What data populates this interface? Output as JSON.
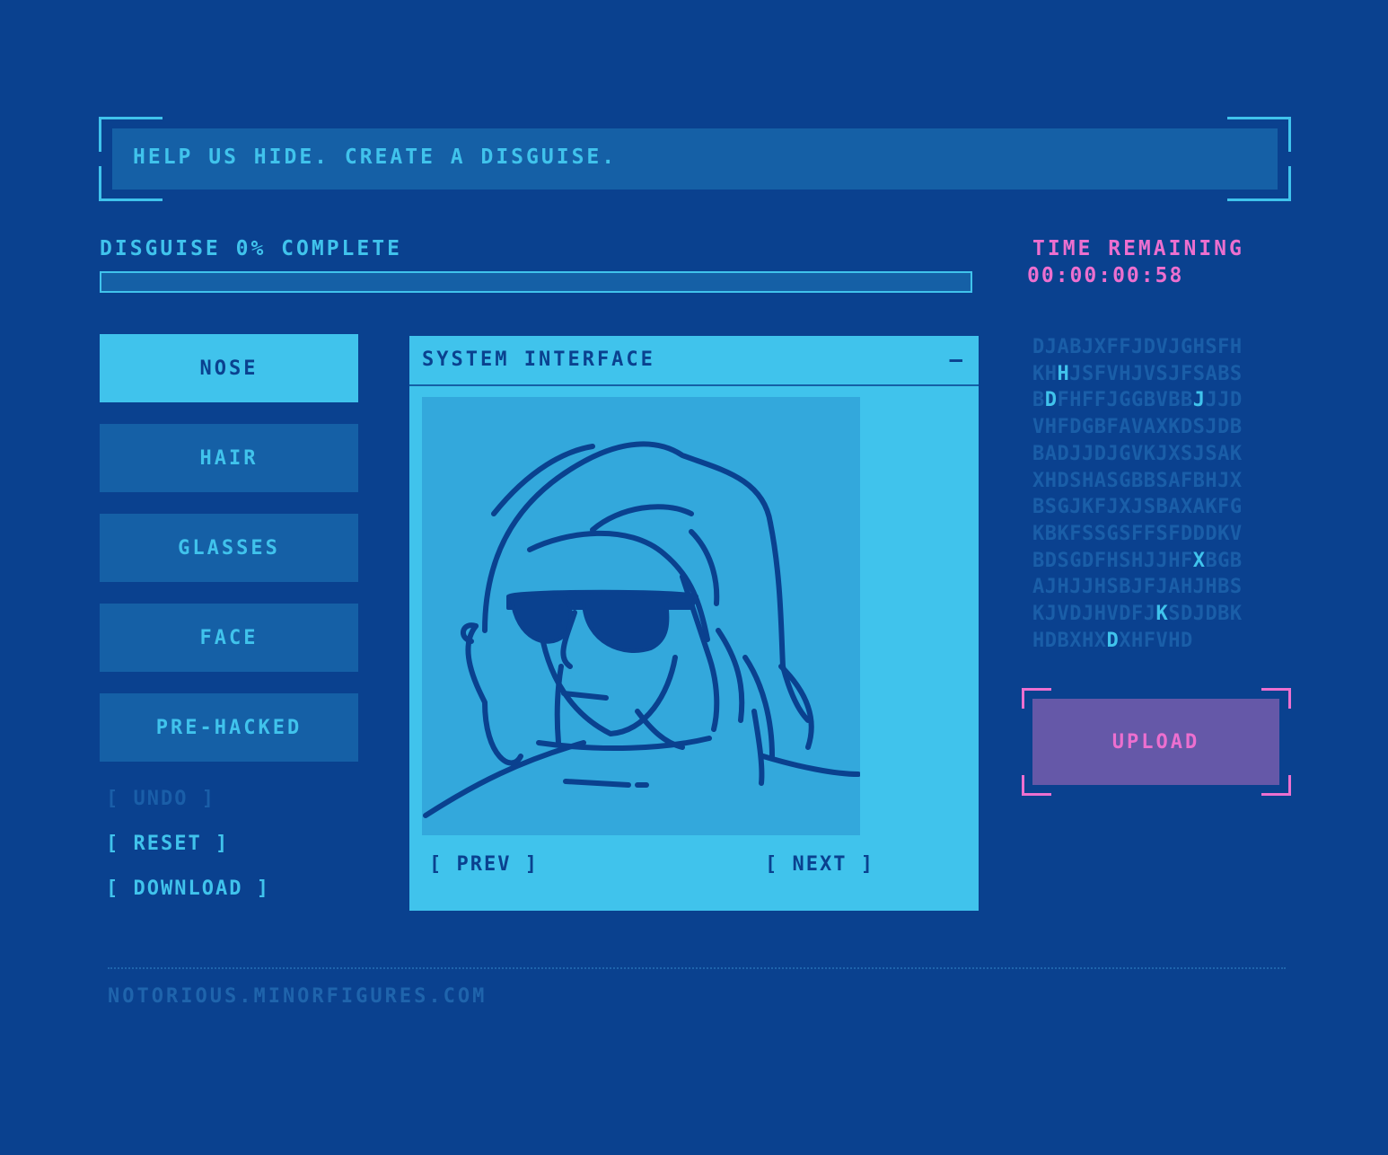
{
  "banner": {
    "text": "HELP US HIDE. CREATE A DISGUISE."
  },
  "progress": {
    "label": "DISGUISE 0% COMPLETE",
    "percent": 0
  },
  "timer": {
    "label": "TIME REMAINING",
    "value": "00:00:00:58"
  },
  "categories": [
    {
      "label": "NOSE",
      "active": true
    },
    {
      "label": "HAIR",
      "active": false
    },
    {
      "label": "GLASSES",
      "active": false
    },
    {
      "label": "FACE",
      "active": false
    },
    {
      "label": "PRE-HACKED",
      "active": false
    }
  ],
  "actions": {
    "undo": "[ UNDO ]",
    "reset": "[ RESET ]",
    "download": "[ DOWNLOAD ]"
  },
  "panel": {
    "title": "SYSTEM INTERFACE",
    "minimize": "—",
    "prev": "[ PREV ]",
    "next": "[ NEXT ]"
  },
  "code_lines": [
    "DJABJXFFJDVJGHSFH",
    "KHHJSFVHJVSJFSABS",
    "BDFHFFJGGBVBBJJJD",
    "VHFDGBFAVAXKDSJDB",
    "BADJJDJGVKJXSJSAK",
    "XHDSHASGBBSAFBHJX",
    "BSGJKFJXJSBAXAKFG",
    "KBKFSSGSFFSFDDDKV",
    "BDSGDFHSHJJHFXBGB",
    "AJHJJHSBJFJAHJHBS",
    "KJVDJHVDFJKSDJDBK",
    "HDBXHXDXHFVHD"
  ],
  "upload": {
    "label": "UPLOAD"
  },
  "footer": {
    "text": "NOTORIOUS.MINORFIGURES.COM"
  },
  "colors": {
    "background": "#0a418f",
    "accent": "#40c3ec",
    "button": "#1560a6",
    "pink": "#ec6fcf",
    "upload_bg": "#6558a8"
  }
}
